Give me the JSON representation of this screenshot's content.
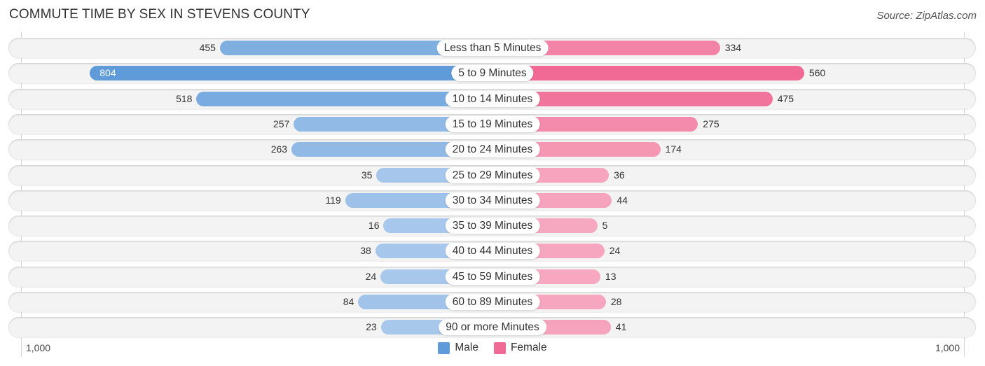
{
  "header": {
    "title": "COMMUTE TIME BY SEX IN STEVENS COUNTY",
    "source": "Source: ZipAtlas.com"
  },
  "colors": {
    "male": "#5f9bd9",
    "male_light": "#a9c8ec",
    "female": "#f06a95",
    "female_light": "#f7a9c1"
  },
  "chart_data": {
    "type": "bar",
    "orientation": "horizontal-diverging",
    "title": "COMMUTE TIME BY SEX IN STEVENS COUNTY",
    "categories": [
      "Less than 5 Minutes",
      "5 to 9 Minutes",
      "10 to 14 Minutes",
      "15 to 19 Minutes",
      "20 to 24 Minutes",
      "25 to 29 Minutes",
      "30 to 34 Minutes",
      "35 to 39 Minutes",
      "40 to 44 Minutes",
      "45 to 59 Minutes",
      "60 to 89 Minutes",
      "90 or more Minutes"
    ],
    "series": [
      {
        "name": "Male",
        "values": [
          455,
          804,
          518,
          257,
          263,
          35,
          119,
          16,
          38,
          24,
          84,
          23
        ]
      },
      {
        "name": "Female",
        "values": [
          334,
          560,
          475,
          275,
          174,
          36,
          44,
          5,
          24,
          13,
          28,
          41
        ]
      }
    ],
    "axis": {
      "left_label": "1,000",
      "right_label": "1,000",
      "max": 1000
    },
    "legend": {
      "position": "bottom-center",
      "entries": [
        "Male",
        "Female"
      ]
    },
    "xlabel": "",
    "ylabel": "",
    "grid": false
  }
}
